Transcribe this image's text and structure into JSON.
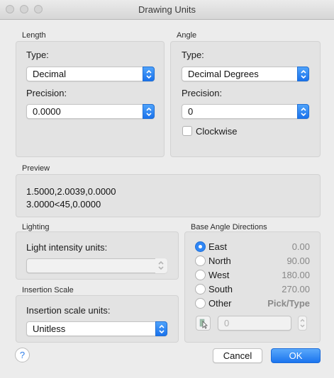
{
  "window": {
    "title": "Drawing Units"
  },
  "length": {
    "section_label": "Length",
    "type_label": "Type:",
    "type_value": "Decimal",
    "precision_label": "Precision:",
    "precision_value": "0.0000"
  },
  "angle": {
    "section_label": "Angle",
    "type_label": "Type:",
    "type_value": "Decimal Degrees",
    "precision_label": "Precision:",
    "precision_value": "0",
    "clockwise_label": "Clockwise",
    "clockwise_checked": false
  },
  "preview": {
    "section_label": "Preview",
    "line1": "1.5000,2.0039,0.0000",
    "line2": "3.0000<45,0.0000"
  },
  "lighting": {
    "section_label": "Lighting",
    "intensity_label": "Light intensity units:",
    "intensity_value": ""
  },
  "insertion": {
    "section_label": "Insertion Scale",
    "units_label": "Insertion scale units:",
    "units_value": "Unitless"
  },
  "base_angle": {
    "section_label": "Base Angle Directions",
    "options": [
      {
        "label": "East",
        "value": "0.00",
        "selected": true
      },
      {
        "label": "North",
        "value": "90.00",
        "selected": false
      },
      {
        "label": "West",
        "value": "180.00",
        "selected": false
      },
      {
        "label": "South",
        "value": "270.00",
        "selected": false
      },
      {
        "label": "Other",
        "value": "Pick/Type",
        "selected": false
      }
    ],
    "other_value": "0"
  },
  "buttons": {
    "help": "?",
    "cancel": "Cancel",
    "ok": "OK"
  },
  "colors": {
    "accent": "#2f86f5",
    "panel": "#e3e3e3",
    "background": "#ececec"
  }
}
